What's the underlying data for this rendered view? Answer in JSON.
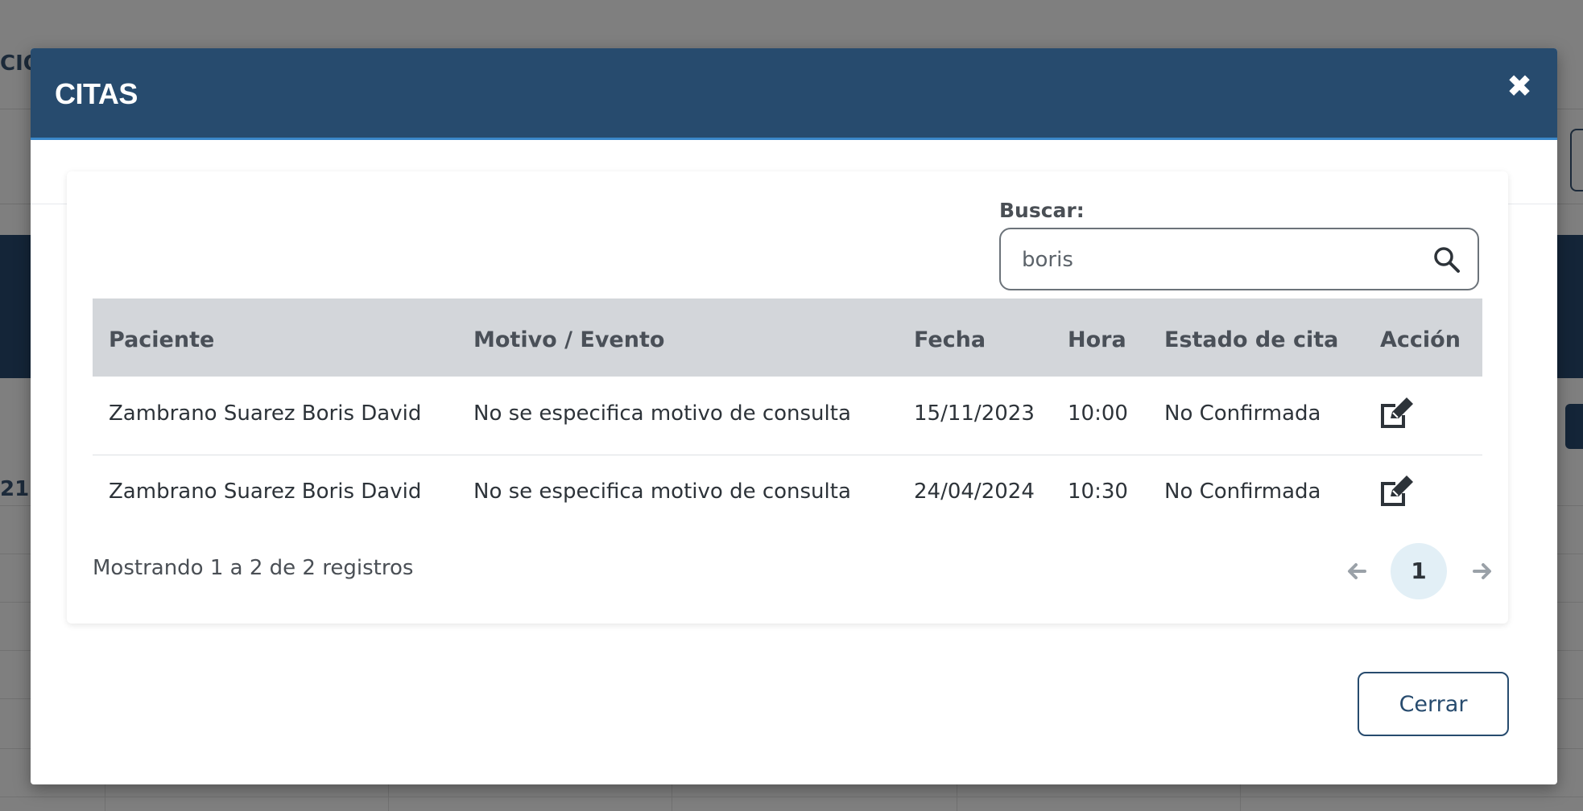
{
  "background": {
    "top_text": "CIO",
    "side_number": "21"
  },
  "modal": {
    "title": "CITAS",
    "search": {
      "label": "Buscar:",
      "value": "boris",
      "placeholder": ""
    },
    "table": {
      "columns": [
        "Paciente",
        "Motivo / Evento",
        "Fecha",
        "Hora",
        "Estado de cita",
        "Acción"
      ],
      "rows": [
        {
          "paciente": "Zambrano Suarez Boris David",
          "motivo": "No se especifica motivo de consulta",
          "fecha": "15/11/2023",
          "hora": "10:00",
          "estado": "No Confirmada",
          "accion_icon": "edit-icon"
        },
        {
          "paciente": "Zambrano Suarez Boris David",
          "motivo": "No se especifica motivo de consulta",
          "fecha": "24/04/2024",
          "hora": "10:30",
          "estado": "No Confirmada",
          "accion_icon": "edit-icon"
        }
      ]
    },
    "info": "Mostrando 1 a 2 de 2 registros",
    "pagination": {
      "current_page": "1"
    },
    "close_button_label": "Cerrar"
  },
  "colors": {
    "header": "#274b6e",
    "header_border": "#3a87c9",
    "table_header": "#d3d6da",
    "active_page": "#e2eff6"
  }
}
